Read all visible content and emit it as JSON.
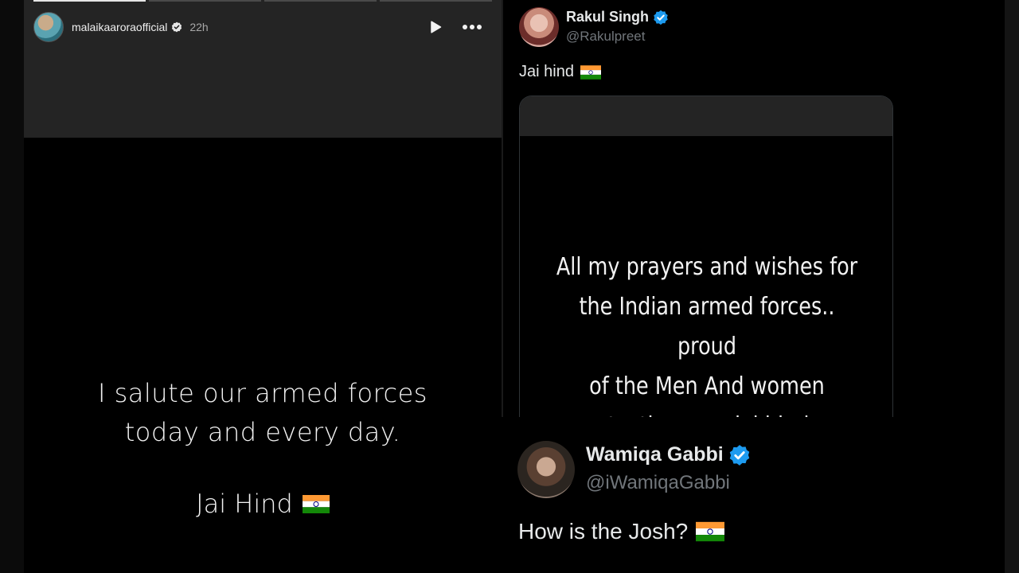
{
  "story": {
    "username": "malaikaaroraofficial",
    "time": "22h",
    "line1": "I salute our armed forces",
    "line2": "today and every day.",
    "sign": "Jai Hind",
    "icons": [
      "verified-icon",
      "play-icon",
      "more-icon",
      "india-flag-icon"
    ]
  },
  "tweet1": {
    "name": "Rakul Singh",
    "handle": "@Rakulpreet",
    "text": "Jai hind",
    "media_lines": [
      "All my prayers and wishes for",
      "the Indian armed forces.. proud",
      "of the Men And women",
      "protecting us .. jai hind"
    ]
  },
  "tweet2": {
    "name": "Wamiqa Gabbi",
    "handle": "@iWamiqaGabbi",
    "text": "How is the Josh?"
  },
  "colors": {
    "verified_blue": "#1d9bf0",
    "handle_gray": "#71767b",
    "flag_saffron": "#ff9933",
    "flag_green": "#138808",
    "chakra_navy": "#000080"
  }
}
